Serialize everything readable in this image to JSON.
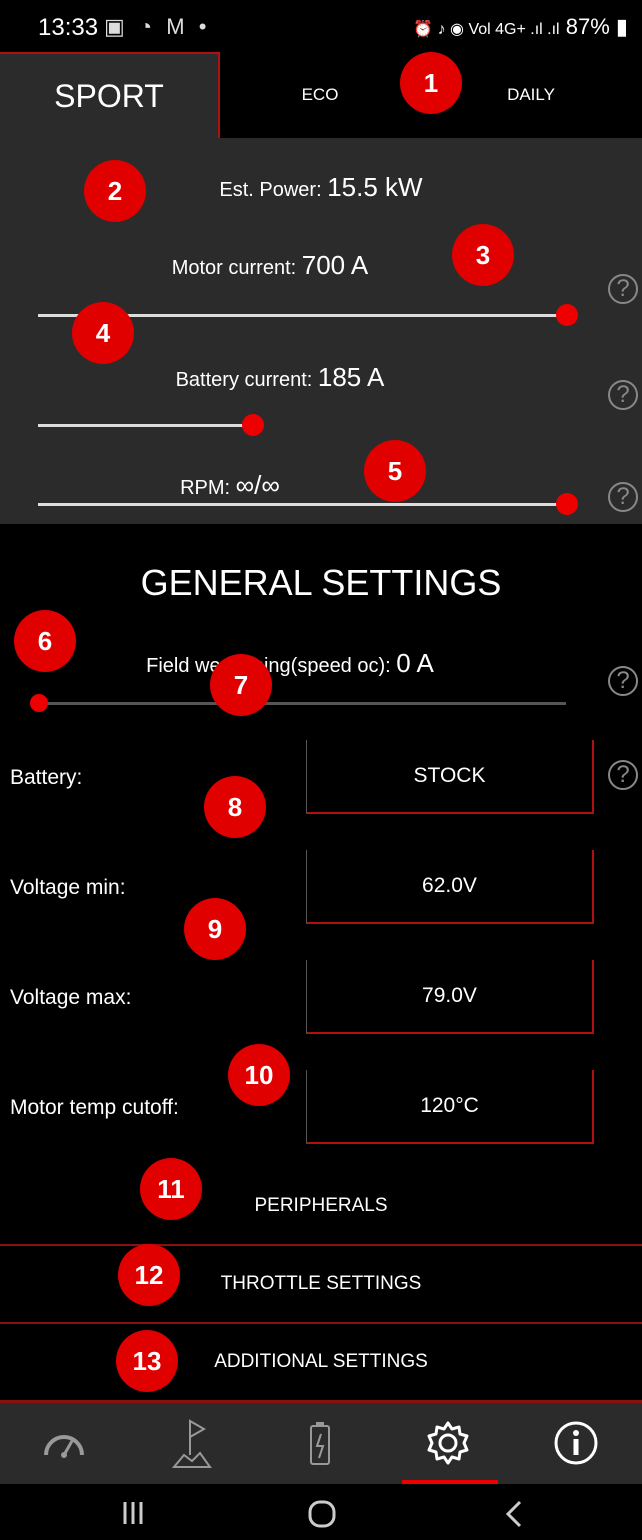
{
  "status_bar": {
    "time": "13:33",
    "left_icons": "▣ ◔ M •",
    "right_icons": "⏰ ♪ ◉ Vol 4G+ .ıl .ıl",
    "battery": "87%"
  },
  "tabs": [
    {
      "label": "SPORT",
      "active": true
    },
    {
      "label": "ECO",
      "active": false
    },
    {
      "label": "DAILY",
      "active": false
    }
  ],
  "profile": {
    "est_power_label": "Est. Power:",
    "est_power_value": "15.5 kW",
    "motor_current_label": "Motor current:",
    "motor_current_value": "700 A",
    "motor_current_fraction": 1.0,
    "battery_current_label": "Battery current:",
    "battery_current_value": "185 A",
    "battery_current_fraction": 0.4,
    "rpm_label": "RPM:",
    "rpm_value": "∞/∞",
    "rpm_fraction": 1.0
  },
  "general": {
    "title": "GENERAL SETTINGS",
    "field_weakening_label": "Field weakening(speed oc):",
    "field_weakening_value": "0 A",
    "field_weakening_fraction": 0.0,
    "rows": [
      {
        "label": "Battery:",
        "value": "STOCK"
      },
      {
        "label": "Voltage min:",
        "value": "62.0V"
      },
      {
        "label": "Voltage max:",
        "value": "79.0V"
      },
      {
        "label": "Motor temp cutoff:",
        "value": "120°C"
      }
    ]
  },
  "menu": {
    "peripherals": "PERIPHERALS",
    "throttle": "THROTTLE SETTINGS",
    "additional": "ADDITIONAL SETTINGS"
  },
  "badges": [
    "1",
    "2",
    "3",
    "4",
    "5",
    "6",
    "7",
    "8",
    "9",
    "10",
    "11",
    "12",
    "13"
  ],
  "help_glyph": "?",
  "bottom_nav": [
    "speedometer-icon",
    "route-flag-icon",
    "battery-icon",
    "settings-gear-icon",
    "info-icon"
  ],
  "colors": {
    "accent": "#e10000",
    "panel": "#2b2b2b",
    "border": "#b01010"
  }
}
